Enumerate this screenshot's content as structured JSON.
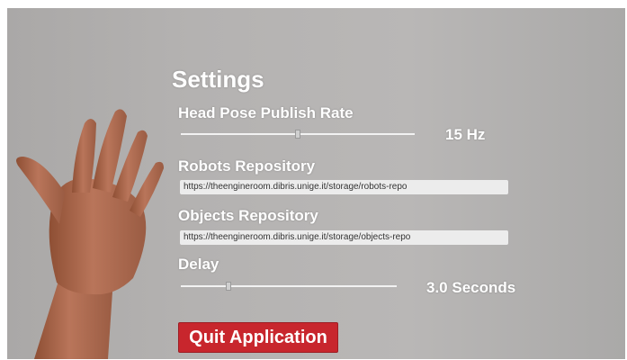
{
  "settings": {
    "title": "Settings",
    "head_pose": {
      "label": "Head Pose Publish Rate",
      "value_text": "15 Hz",
      "slider_fraction": 0.5
    },
    "robots_repo": {
      "label": "Robots Repository",
      "url": "https://theengineroom.dibris.unige.it/storage/robots-repo"
    },
    "objects_repo": {
      "label": "Objects Repository",
      "url": "https://theengineroom.dibris.unige.it/storage/objects-repo"
    },
    "delay": {
      "label": "Delay",
      "value_text": "3.0 Seconds",
      "slider_fraction": 0.22
    },
    "quit_label": "Quit Application"
  },
  "colors": {
    "quit_button": "#c8262d",
    "text": "#ffffff",
    "field_bg": "#ececec"
  }
}
